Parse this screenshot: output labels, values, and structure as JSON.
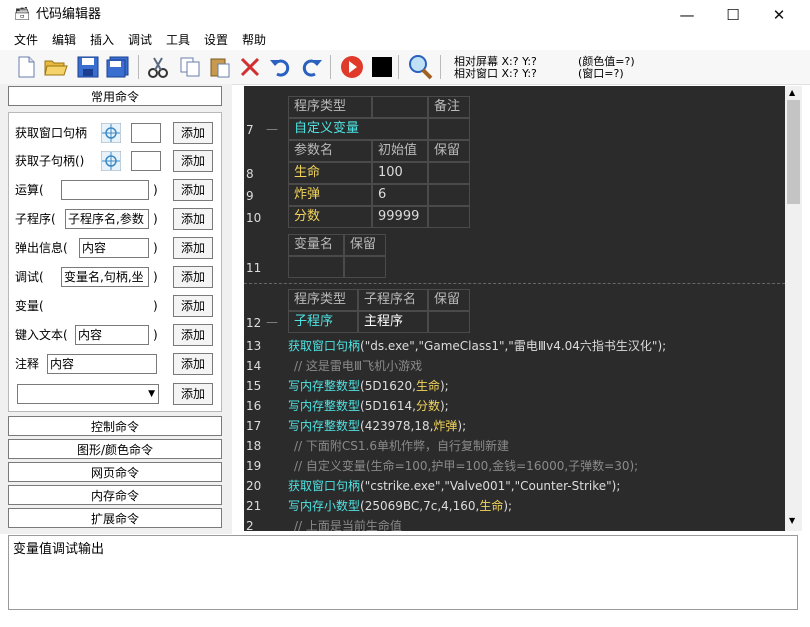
{
  "window": {
    "title": "代码编辑器"
  },
  "menu": [
    "文件",
    "编辑",
    "插入",
    "调试",
    "工具",
    "设置",
    "帮助"
  ],
  "coords": {
    "screen": "相对屏幕 X:? Y:?",
    "window": "相对窗口 X:? Y:?",
    "color": "(颜色值=?)",
    "handle": "(窗口=?)"
  },
  "left": {
    "common_tab": "常用命令",
    "add_label": "添加",
    "commands": [
      {
        "label": "获取窗口句柄"
      },
      {
        "label": "获取子句柄()"
      },
      {
        "label": "运算(",
        "suffix": ")"
      },
      {
        "label": "子程序(",
        "value": "子程序名,参数",
        "suffix": ")"
      },
      {
        "label": "弹出信息(",
        "value": "内容",
        "suffix": ")"
      },
      {
        "label": "调试(",
        "value": "变量名,句柄,坐",
        "suffix": ")"
      },
      {
        "label": "变量(",
        "suffix": ")"
      },
      {
        "label": "键入文本(",
        "value": "内容",
        "suffix": ")"
      },
      {
        "label": "注释",
        "value": "内容"
      }
    ],
    "categories": [
      "控制命令",
      "图形/颜色命令",
      "网页命令",
      "内存命令",
      "扩展命令"
    ]
  },
  "editor": {
    "var_table": {
      "headers": [
        "程序类型",
        "",
        "备注"
      ],
      "type": "自定义变量",
      "param_headers": [
        "参数名",
        "初始值",
        "保留"
      ],
      "rows": [
        {
          "line": "8",
          "name": "生命",
          "value": "100"
        },
        {
          "line": "9",
          "name": "炸弹",
          "value": "6"
        },
        {
          "line": "10",
          "name": "分数",
          "value": "99999"
        }
      ],
      "line": "7"
    },
    "var_table2": {
      "headers": [
        "变量名",
        "保留"
      ],
      "line": "11"
    },
    "sub_table": {
      "headers": [
        "程序类型",
        "子程序名",
        "保留"
      ],
      "type": "子程序",
      "name": "主程序",
      "line": "12"
    },
    "code_lines": [
      {
        "line": "13",
        "kind": "fn",
        "fn": "获取窗口句柄",
        "rest": "(\"ds.exe\",\"GameClass1\",\"雷电Ⅲv4.04六指书生汉化\");"
      },
      {
        "line": "14",
        "kind": "comment",
        "text": "// 这是雷电Ⅲ飞机小游戏"
      },
      {
        "line": "15",
        "kind": "fn",
        "fn": "写内存整数型",
        "rest_a": "(5D1620,",
        "var": "生命",
        "rest_b": ");"
      },
      {
        "line": "16",
        "kind": "fn",
        "fn": "写内存整数型",
        "rest_a": "(5D1614,",
        "var": "分数",
        "rest_b": ");"
      },
      {
        "line": "17",
        "kind": "fn",
        "fn": "写内存整数型",
        "rest_a": "(423978,18,",
        "var": "炸弹",
        "rest_b": ");"
      },
      {
        "line": "18",
        "kind": "comment",
        "text": "// 下面附CS1.6单机作弊，自行复制新建"
      },
      {
        "line": "19",
        "kind": "comment",
        "text": "// 自定义变量(生命=100,护甲=100,金钱=16000,子弹数=30);"
      },
      {
        "line": "20",
        "kind": "fn",
        "fn": "获取窗口句柄",
        "rest": "(\"cstrike.exe\",\"Valve001\",\"Counter-Strike\");"
      },
      {
        "line": "21",
        "kind": "fn",
        "fn": "写内存小数型",
        "rest_a": "(25069BC,7c,4,160,",
        "var": "生命",
        "rest_b": ");"
      },
      {
        "line": "2",
        "kind": "comment",
        "text": "// 上面是当前生命值"
      }
    ]
  },
  "output": {
    "text": "变量值调试输出"
  },
  "colors": {
    "editor_bg": "#2b2b2b",
    "fn": "#4fe3e3",
    "var": "#f2d45c",
    "comment": "#8a8a8a",
    "text": "#dcdcdc"
  }
}
